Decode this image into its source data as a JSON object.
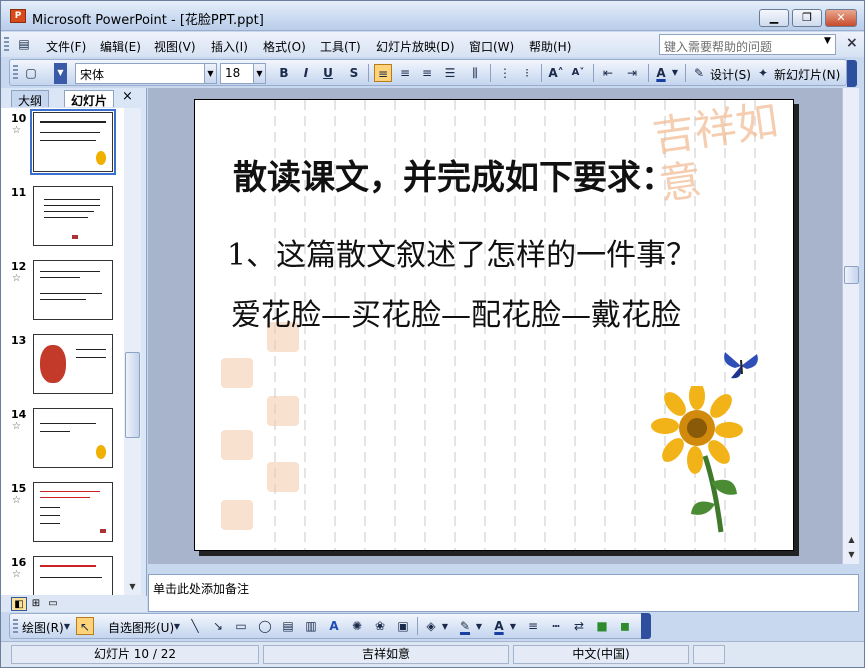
{
  "window": {
    "app_icon_label": "P",
    "title": "Microsoft PowerPoint - [花脸PPT.ppt]",
    "minimize": "▁",
    "restore": "❐",
    "close": "✕"
  },
  "menu": {
    "items": [
      "文件(F)",
      "编辑(E)",
      "视图(V)",
      "插入(I)",
      "格式(O)",
      "工具(T)",
      "幻灯片放映(D)",
      "窗口(W)",
      "帮助(H)"
    ],
    "help_placeholder": "键入需要帮助的问题",
    "close_doc": "×"
  },
  "toolbar": {
    "font_name": "宋体",
    "font_size": "18",
    "bold": "B",
    "italic": "I",
    "underline": "U",
    "shadow": "S",
    "design_label": "设计(S)",
    "new_slide_label": "新幻灯片(N)"
  },
  "panel": {
    "tab_outline": "大纲",
    "tab_slides": "幻灯片",
    "close": "×",
    "slides": [
      {
        "number": "10",
        "star": "☆"
      },
      {
        "number": "11",
        "star": ""
      },
      {
        "number": "12",
        "star": "☆"
      },
      {
        "number": "13",
        "star": ""
      },
      {
        "number": "14",
        "star": "☆"
      },
      {
        "number": "15",
        "star": "☆"
      },
      {
        "number": "16",
        "star": "☆"
      }
    ]
  },
  "slide": {
    "title": "散读课文，并完成如下要求：",
    "line1": "1、这篇散文叙述了怎样的一件事？",
    "line2": "爱花脸—买花脸—配花脸—戴花脸",
    "deco_text": "吉祥如意"
  },
  "notes": {
    "placeholder": "单击此处添加备注"
  },
  "drawing": {
    "draw_label": "绘图(R)",
    "autoshape_label": "自选图形(U)"
  },
  "status": {
    "slide_position": "幻灯片 10 / 22",
    "design_name": "吉祥如意",
    "language": "中文(中国)"
  },
  "colors": {
    "accent": "#2d4f9e",
    "selected_thumb": "#3b6fd0"
  }
}
